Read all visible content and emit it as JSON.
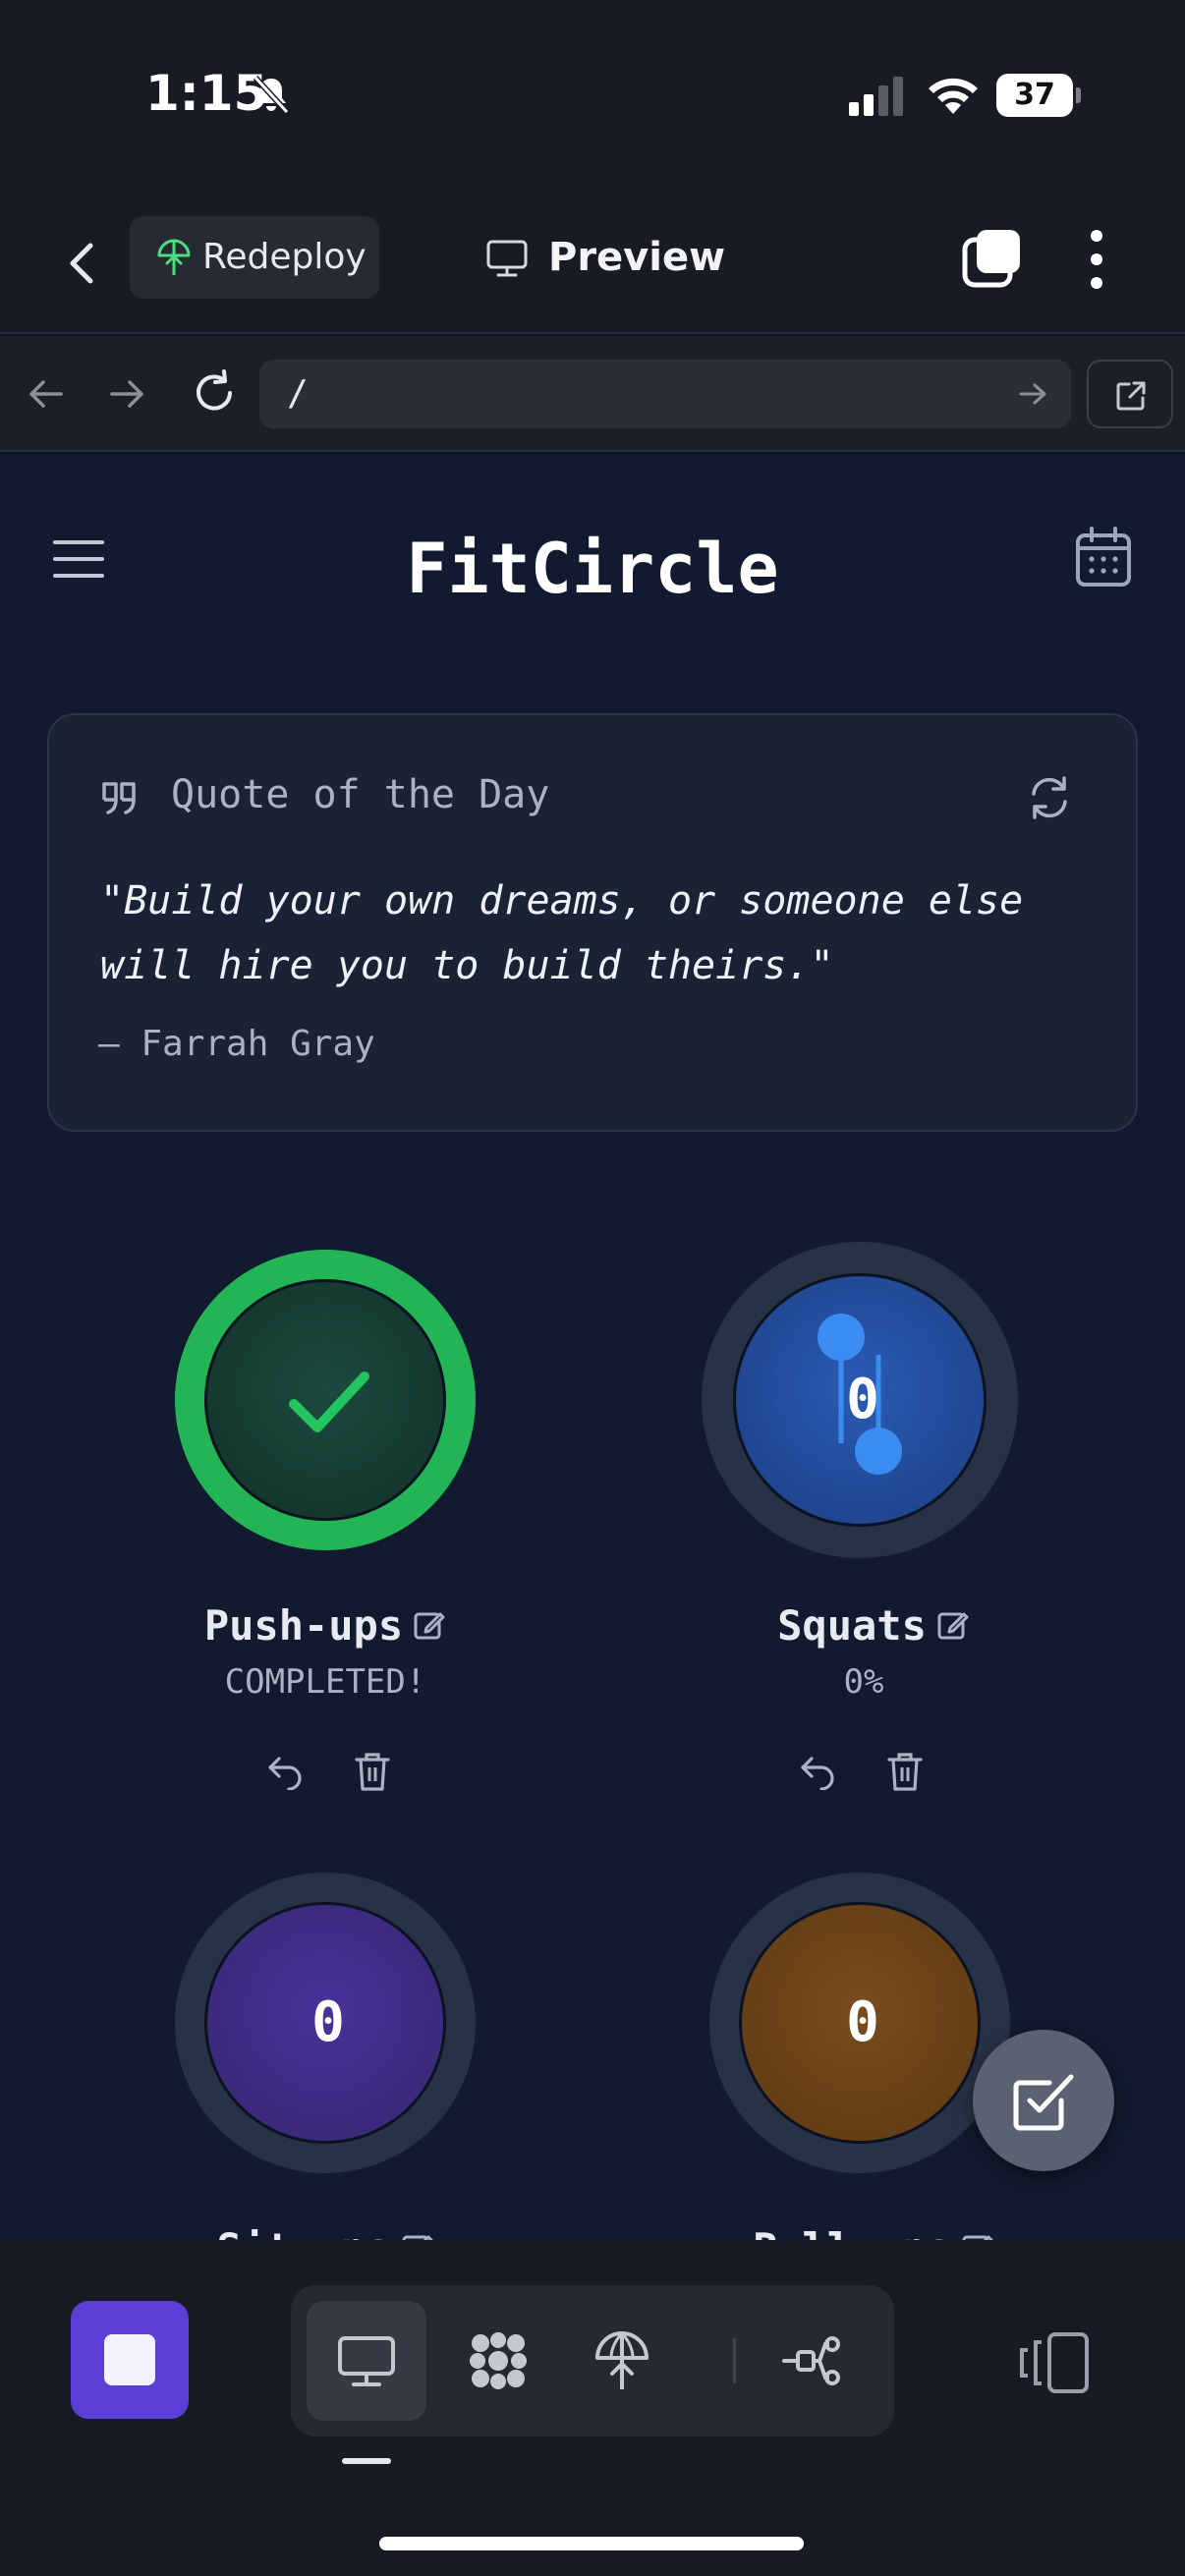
{
  "status_bar": {
    "time": "1:15",
    "battery": "37"
  },
  "toolbar": {
    "redeploy_label": "Redeploy",
    "preview_label": "Preview"
  },
  "url_bar": {
    "url": "/"
  },
  "app": {
    "title": "FitCircle",
    "quote": {
      "heading": "Quote of the Day",
      "text": "\"Build your own dreams, or someone else will hire you to build theirs.\"",
      "author": "— Farrah Gray"
    },
    "exercises": [
      {
        "name": "Push-ups",
        "status": "COMPLETED!",
        "count": "",
        "completed": true,
        "color": "#22b455"
      },
      {
        "name": "Squats",
        "status": "0%",
        "count": "0",
        "completed": false,
        "color": "#1f4fa8"
      },
      {
        "name": "Sit-ups",
        "status": "",
        "count": "0",
        "completed": false,
        "color": "#3c2a80"
      },
      {
        "name": "Pull-ups",
        "status": "",
        "count": "0",
        "completed": false,
        "color": "#6e4418"
      }
    ]
  },
  "colors": {
    "accent": "#5b3fd6",
    "success": "#22b455",
    "background": "#111a2e"
  }
}
